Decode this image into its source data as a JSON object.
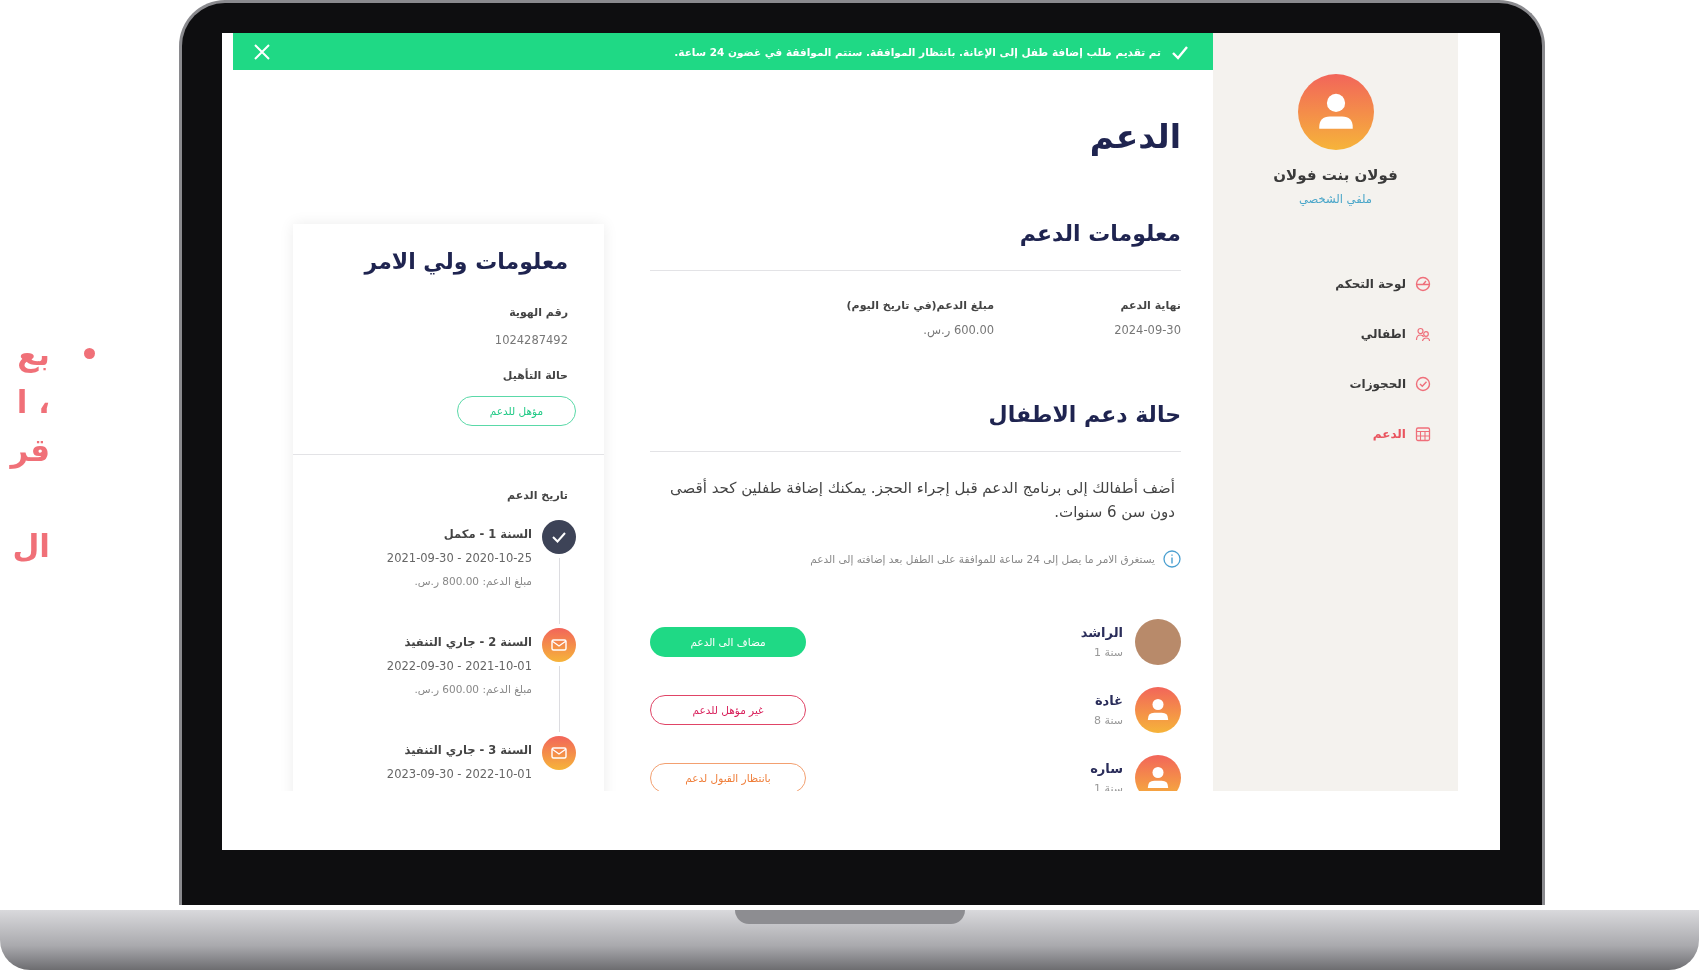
{
  "slide_text": {
    "lines": [
      "بع",
      "، ا",
      "قر",
      "ال"
    ]
  },
  "banner": {
    "message": "تم تقديم طلب إضافة طفل إلى الإعانة. بانتظار الموافقة. ستتم الموافقة في غضون 24 ساعة."
  },
  "sidebar": {
    "user_name": "فولان بنت فولان",
    "profile_link": "ملفي الشخصي",
    "items": [
      {
        "label": "لوحة التحكم",
        "kind": "dashboard",
        "selected": false
      },
      {
        "label": "اطفالي",
        "kind": "children",
        "selected": false
      },
      {
        "label": "الحجوزات",
        "kind": "bookings",
        "selected": false
      },
      {
        "label": "الدعم",
        "kind": "support",
        "selected": true
      }
    ]
  },
  "page_title": "الدعم",
  "support_info": {
    "heading": "معلومات الدعم",
    "fields": [
      {
        "label": "نهاية الدعم",
        "value": "2024-09-30"
      },
      {
        "label": "مبلغ الدعم(في تاريخ اليوم)",
        "value": "600.00 ر.س."
      }
    ]
  },
  "children_status": {
    "heading": "حالة دعم الاطفال",
    "description": "أضف أطفالك إلى برنامج الدعم قبل إجراء الحجز. يمكنك إضافة طفلين كحد أقصى دون سن 6 سنوات.",
    "note": "يستغرق الامر ما يصل إلى 24 ساعة للموافقة على الطفل بعد إضافته إلى الدعم",
    "children": [
      {
        "name": "الراشد",
        "age": "1 سنة",
        "photo": true,
        "kind": "added",
        "status_label": "مضاف الى الدعم"
      },
      {
        "name": "غادة",
        "age": "8 سنة",
        "photo": false,
        "kind": "ineligible",
        "status_label": "غير مؤهل للدعم"
      },
      {
        "name": "ساره",
        "age": "1 سنة",
        "photo": false,
        "kind": "pending",
        "status_label": "بانتظار القبول لدعم"
      }
    ]
  },
  "guardian": {
    "heading": "معلومات ولي الامر",
    "id_label": "رقم الهوية",
    "id_value": "1024287492",
    "eligibility_label": "حالة التأهيل",
    "eligibility": "مؤهل للدعم",
    "history_label": "تاريخ الدعم",
    "history": [
      {
        "kind": "completed",
        "title": "السنة 1 - مكمل",
        "dates": "2021-09-30 - 2020-10-25",
        "amount": "مبلغ الدعم: 800.00 ر.س."
      },
      {
        "kind": "active",
        "title": "السنة 2 - جاري التنفيذ",
        "dates": "2022-09-30 - 2021-10-01",
        "amount": "مبلغ الدعم: 600.00 ر.س."
      },
      {
        "kind": "active",
        "title": "السنة 3 - جاري التنفيذ",
        "dates": "2023-09-30 - 2022-10-01"
      }
    ]
  }
}
